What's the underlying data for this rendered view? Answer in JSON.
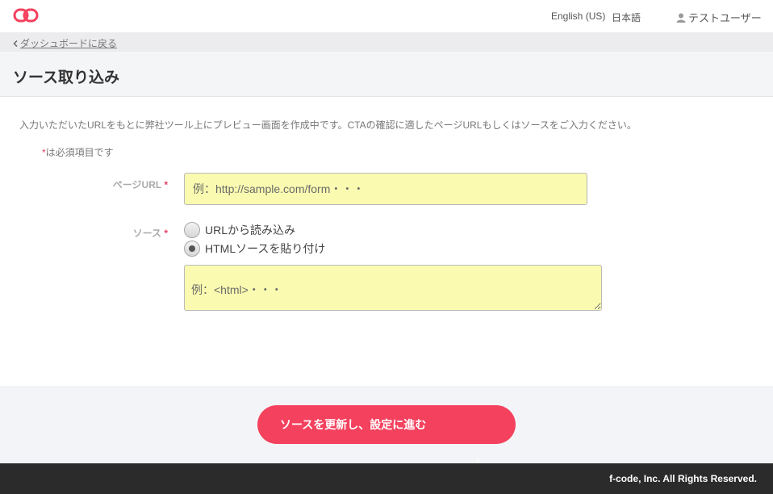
{
  "header": {
    "logo_icon": "chain-link-logo-icon",
    "lang_en": "English (US)",
    "lang_ja": "日本語",
    "user_icon": "person-icon",
    "user_name": "テストユーザー"
  },
  "breadcrumb": {
    "back_icon": "chevron-left-icon",
    "back_label": "ダッシュボードに戻る"
  },
  "page": {
    "title": "ソース取り込み",
    "intro": "入力いただいたURLをもとに弊社ツール上にプレビュー画面を作成中です。CTAの確認に適したページURLもしくはソースをご入力ください。",
    "required_mark": "*",
    "required_note": "は必須項目です"
  },
  "form": {
    "url_label": "ページURL",
    "url_placeholder": "例：http://sample.com/form・・・",
    "source_label": "ソース",
    "source_options": [
      {
        "label": "URLから読み込み",
        "selected": false
      },
      {
        "label": "HTMLソースを貼り付け",
        "selected": true
      }
    ],
    "source_placeholder": "例：<html>・・・"
  },
  "actions": {
    "submit_label": "ソースを更新し、設定に進む",
    "submit_color": "#f4415e"
  },
  "footer": {
    "copyright": "f-code, Inc. All Rights Reserved."
  },
  "colors": {
    "accent": "#e4406a",
    "input_bg": "#fafbb0",
    "footer_bg": "#2b2b2b"
  }
}
